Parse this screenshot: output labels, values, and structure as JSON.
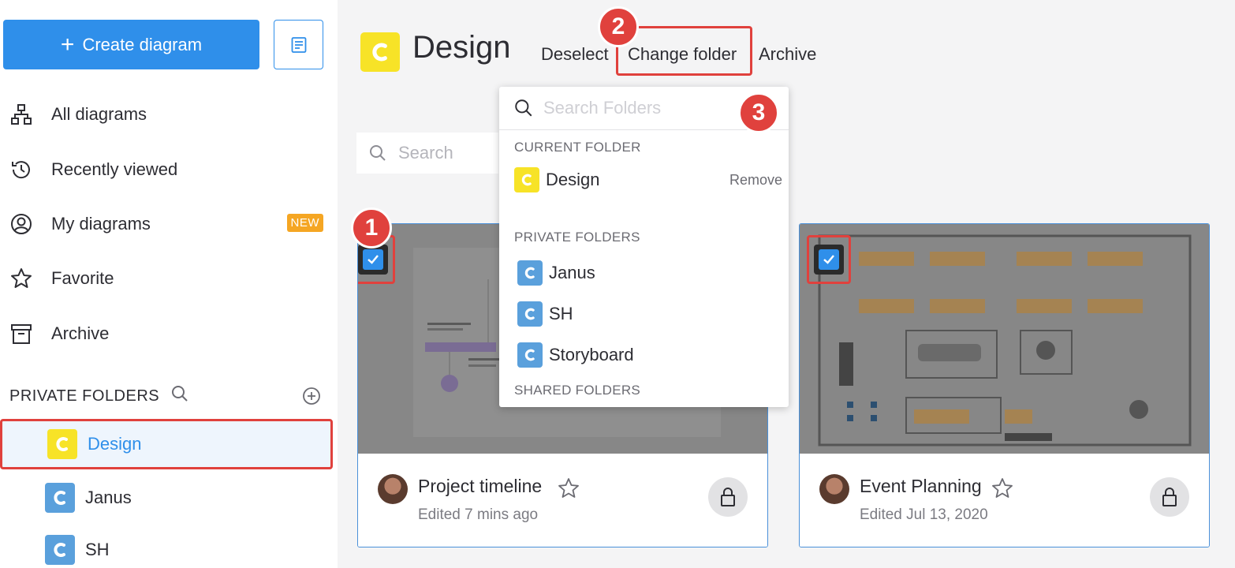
{
  "sidebar": {
    "create_label": "Create diagram",
    "nav": [
      {
        "label": "All diagrams",
        "icon": "sitemap-icon"
      },
      {
        "label": "Recently viewed",
        "icon": "history-icon"
      },
      {
        "label": "My diagrams",
        "icon": "user-circle-icon",
        "badge": "NEW"
      },
      {
        "label": "Favorite",
        "icon": "star-icon"
      },
      {
        "label": "Archive",
        "icon": "archive-icon"
      }
    ],
    "private_folders_header": "PRIVATE FOLDERS",
    "folders": [
      {
        "label": "Design",
        "color": "yellow",
        "active": true
      },
      {
        "label": "Janus",
        "color": "blue"
      },
      {
        "label": "SH",
        "color": "blue"
      }
    ]
  },
  "main": {
    "title": "Design",
    "actions": {
      "deselect": "Deselect",
      "change_folder": "Change folder",
      "archive": "Archive"
    },
    "search_placeholder": "Search",
    "cards": [
      {
        "title": "Project timeline",
        "subtitle": "Edited 7 mins ago",
        "checked": true
      },
      {
        "title": "Event Planning",
        "subtitle": "Edited Jul 13, 2020",
        "checked": true
      }
    ]
  },
  "dropdown": {
    "search_placeholder": "Search Folders",
    "current_folder_header": "CURRENT FOLDER",
    "current_folder": "Design",
    "remove_label": "Remove",
    "private_folders_header": "PRIVATE FOLDERS",
    "private_folders": [
      "Janus",
      "SH",
      "Storyboard"
    ],
    "shared_folders_header": "SHARED FOLDERS"
  },
  "markers": [
    "1",
    "2",
    "3"
  ],
  "colors": {
    "accent": "#2f8fea",
    "marker": "#e0413d",
    "folder_yellow": "#f7e327",
    "folder_blue": "#5aa0dc",
    "badge": "#f5a623"
  }
}
